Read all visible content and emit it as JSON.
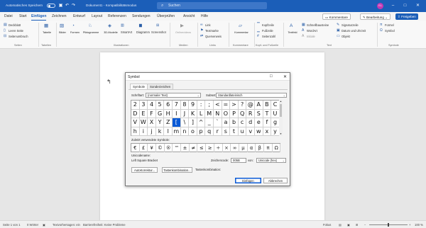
{
  "titlebar": {
    "autosave": "Automatisches Speichern",
    "doc_title": "Dokument1  -  Kompatibilitätsmodus",
    "search_placeholder": "Suchen",
    "avatar_initials": "EL"
  },
  "menu": {
    "tabs": [
      "Datei",
      "Start",
      "Einfügen",
      "Zeichnen",
      "Entwurf",
      "Layout",
      "Referenzen",
      "Sendungen",
      "Überprüfen",
      "Ansicht",
      "Hilfe"
    ],
    "active_tab": "Einfügen",
    "comments_btn": "Kommentare",
    "editing_btn": "Bearbeitung",
    "share_btn": "Freigeben"
  },
  "ribbon": {
    "pages": {
      "items": [
        "Deckblatt",
        "Leere Seite",
        "Seitenumbruch"
      ],
      "label": "Seiten"
    },
    "tables": {
      "item": "Tabelle",
      "label": "Tabellen"
    },
    "illustrations": {
      "items": [
        "Bilder",
        "Formen",
        "Piktogramme",
        "3D-Modelle",
        "SmartArt",
        "Diagramm",
        "Screenshot"
      ],
      "label": "Illustrationen"
    },
    "media": {
      "item": "Onlinevideos",
      "label": "Medien"
    },
    "links": {
      "items": [
        "Link",
        "Textmarke",
        "Querverweis"
      ],
      "label": "Links"
    },
    "comments": {
      "item": "Kommentar",
      "label": "Kommentare"
    },
    "header_footer": {
      "items": [
        "Kopfzeile",
        "Fußzeile",
        "Seitenzahl"
      ],
      "label": "Kopf- und Fußzeile"
    },
    "text": {
      "items": [
        "Textfeld",
        "Schnellbausteine",
        "WordArt",
        "Initiale",
        "Signaturzeile",
        "Datum und Uhrzeit",
        "Objekt"
      ],
      "label": "Text"
    },
    "symbols": {
      "items": [
        "Formel",
        "Symbol"
      ],
      "label": "Symbole"
    }
  },
  "dialog": {
    "title": "Symbol",
    "tabs": [
      "Symbole",
      "Sonderzeichen"
    ],
    "font_label": "Schriftart:",
    "font_value": "(normaler Text)",
    "subset_label": "Subset:",
    "subset_value": "Standardlateinisch",
    "symbol_grid": [
      [
        "2",
        "3",
        "4",
        "5",
        "6",
        "7",
        "8",
        "9",
        ":",
        ";",
        "<",
        "=",
        ">",
        "?",
        "@",
        "A",
        "B",
        "C"
      ],
      [
        "D",
        "E",
        "F",
        "G",
        "H",
        "I",
        "J",
        "K",
        "L",
        "M",
        "N",
        "O",
        "P",
        "Q",
        "R",
        "S",
        "T",
        "U"
      ],
      [
        "V",
        "W",
        "X",
        "Y",
        "Z",
        "[",
        "\\",
        "]",
        "^",
        "_",
        "`",
        "a",
        "b",
        "c",
        "d",
        "e",
        "f",
        "g"
      ],
      [
        "h",
        "i",
        "j",
        "k",
        "l",
        "m",
        "n",
        "o",
        "p",
        "q",
        "r",
        "s",
        "t",
        "u",
        "v",
        "w",
        "x",
        "y"
      ]
    ],
    "selected_symbol": "[",
    "recent_label": "Zuletzt verwendete Symbole:",
    "recent_symbols": [
      "€",
      "£",
      "¥",
      "©",
      "®",
      "™",
      "±",
      "≠",
      "≤",
      "≥",
      "÷",
      "×",
      "∞",
      "µ",
      "α",
      "β",
      "π",
      "Ω"
    ],
    "unicode_name_label": "Unicodename:",
    "unicode_name": "Left Square Bracket",
    "char_code_label": "Zeichencode:",
    "char_code": "005B",
    "from_label": "von:",
    "from_value": "Unicode (hex)",
    "autocorrect_btn": "AutoKorrektur...",
    "shortcut_btn": "Tastenkombination...",
    "shortcut_text": "Tastenkombination:",
    "insert_btn": "Einfügen",
    "cancel_btn": "Abbrechen"
  },
  "statusbar": {
    "page": "Seite 1 von 1",
    "words": "0 Wörter",
    "language": "Textvorhersagen: ein",
    "accessibility": "Barrierefreiheit: Keine Probleme",
    "focus": "Fokus",
    "zoom": "100 %"
  },
  "colors": {
    "brand": "#1b5eb8",
    "highlight": "#0a5ad6",
    "share": "#1b5eb8"
  }
}
